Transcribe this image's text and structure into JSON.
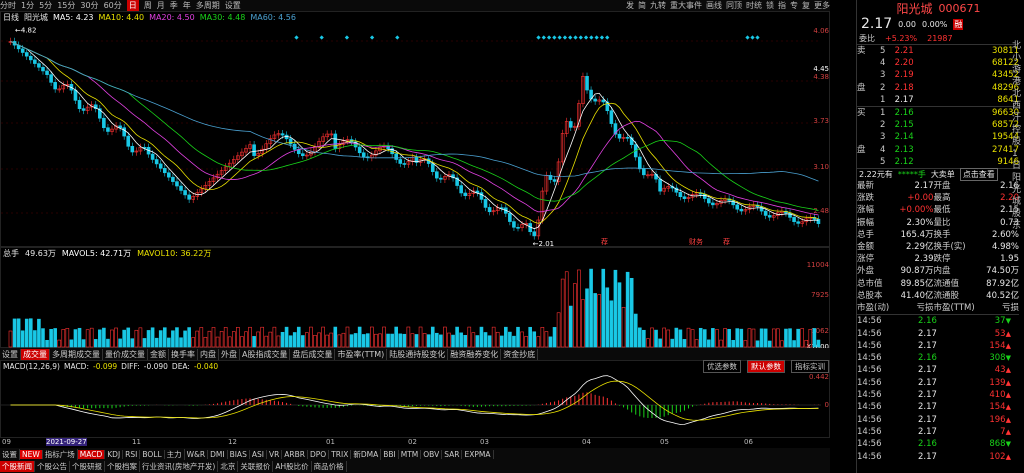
{
  "toolbar": {
    "periods": [
      "分时",
      "1分",
      "5分",
      "15分",
      "30分",
      "60分",
      "日",
      "周",
      "月",
      "季",
      "年",
      "多周期",
      "设置"
    ],
    "active_period": "日",
    "right_items": [
      "发",
      "简",
      "九转",
      "重大事件",
      "画线",
      "同顶",
      "时统",
      "锁",
      "指",
      "专",
      "复",
      "更多"
    ]
  },
  "price_panel": {
    "label": "日线",
    "name": "阳光城",
    "ma": [
      {
        "name": "MA5",
        "value": "4.23"
      },
      {
        "name": "MA10",
        "value": "4.40"
      },
      {
        "name": "MA20",
        "value": "4.50"
      },
      {
        "name": "MA30",
        "value": "4.48"
      },
      {
        "name": "MA60",
        "value": "4.56"
      }
    ],
    "axis": [
      "4.06",
      "4.45",
      "4.38",
      "3.73",
      "3.10",
      "2.48"
    ],
    "high_label": "4.82",
    "low_label": "2.01",
    "marks": [
      "荐",
      "财务",
      "荐"
    ]
  },
  "volume_panel": {
    "label": "总手",
    "value": "49.63万",
    "ma": [
      {
        "name": "MAVOL5",
        "value": "42.71万"
      },
      {
        "name": "MAVOL10",
        "value": "36.22万"
      }
    ],
    "axis": [
      "11004",
      "7925",
      "3062",
      "X1000"
    ]
  },
  "indicator_tabs": [
    "设置",
    "成交量",
    "多周期成交量",
    "量价成交量",
    "金额",
    "换手率",
    "内盘",
    "外盘",
    "A股指成交量",
    "盘后成交量",
    "市盈率(TTM)",
    "陆股通持股变化",
    "融资融券变化",
    "资金抄底"
  ],
  "macd_panel": {
    "label": "MACD(12,26,9)",
    "macd": "-0.099",
    "diff": "-0.090",
    "dea": "-0.040",
    "buttons": [
      "优选参数",
      "默认参数",
      "指标实训"
    ],
    "axis": [
      "0.442",
      "0"
    ]
  },
  "date_axis": {
    "labels": [
      "09",
      "2021-09-27",
      "11",
      "12",
      "01",
      "02",
      "03",
      "04",
      "05",
      "06"
    ]
  },
  "bottom_tabs": [
    "设置",
    "NEW",
    "指标广场",
    "MACD",
    "KDJ",
    "RSI",
    "BOLL",
    "主力",
    "W&R",
    "DMI",
    "BIAS",
    "ASI",
    "VR",
    "ARBR",
    "DPO",
    "TRIX",
    "新DMA",
    "BBI",
    "MTM",
    "OBV",
    "SAR",
    "EXPMA"
  ],
  "bottom_tabs2": [
    "个股新闻",
    "个股公告",
    "个股研报",
    "个股档案",
    "行业资讯(房地产开发)",
    "北京",
    "关联报价",
    "AH股比价",
    "商品价格"
  ],
  "quote": {
    "name": "阳光城",
    "code": "000671",
    "price": "2.17",
    "change": "0.00",
    "pct": "0.00%",
    "tag": "融",
    "weibi_label": "委比",
    "weibi": "+5.23%",
    "weicha": "21987",
    "asks": [
      {
        "lvl": "5",
        "price": "2.21",
        "vol": "30811"
      },
      {
        "lvl": "4",
        "price": "2.20",
        "vol": "68122"
      },
      {
        "lvl": "3",
        "price": "2.19",
        "vol": "43452"
      },
      {
        "lvl": "2",
        "price": "2.18",
        "vol": "48296"
      },
      {
        "lvl": "1",
        "price": "2.17",
        "vol": "8641"
      }
    ],
    "bids": [
      {
        "lvl": "1",
        "price": "2.16",
        "vol": "96630"
      },
      {
        "lvl": "2",
        "price": "2.15",
        "vol": "68572"
      },
      {
        "lvl": "3",
        "price": "2.14",
        "vol": "19544"
      },
      {
        "lvl": "4",
        "price": "2.13",
        "vol": "27417"
      },
      {
        "lvl": "5",
        "price": "2.12",
        "vol": "9146"
      }
    ],
    "ask_side": "卖",
    "bid_side": "买",
    "ask_mid": "盘",
    "bid_mid": "盘",
    "deal_bar": {
      "a": "2.22元有",
      "b": "*****手",
      "c": "大卖单",
      "btn": "点击查看"
    },
    "stats": [
      [
        "最新",
        "2.17",
        "开盘",
        "2.16"
      ],
      [
        "涨跌",
        "+0.00",
        "最高",
        "2.20"
      ],
      [
        "涨幅",
        "+0.00%",
        "最低",
        "2.15"
      ],
      [
        "振幅",
        "2.30%",
        "量比",
        "0.73"
      ],
      [
        "总手",
        "165.4万",
        "换手",
        "2.60%"
      ],
      [
        "金额",
        "2.29亿",
        "换手(实)",
        "4.98%"
      ],
      [
        "涨停",
        "2.39",
        "跌停",
        "1.95"
      ],
      [
        "外盘",
        "90.87万",
        "内盘",
        "74.50万"
      ],
      [
        "总市值",
        "89.85亿",
        "流通值",
        "87.92亿"
      ],
      [
        "总股本",
        "41.40亿",
        "流通股",
        "40.52亿"
      ],
      [
        "市盈(动)",
        "亏损",
        "市盈(TTM)",
        "亏损"
      ]
    ],
    "ticks": [
      [
        "14:56",
        "2.16",
        "37"
      ],
      [
        "14:56",
        "2.17",
        "53"
      ],
      [
        "14:56",
        "2.17",
        "154"
      ],
      [
        "14:56",
        "2.16",
        "308"
      ],
      [
        "14:56",
        "2.17",
        "43"
      ],
      [
        "14:56",
        "2.17",
        "139"
      ],
      [
        "14:56",
        "2.17",
        "410"
      ],
      [
        "14:56",
        "2.17",
        "154"
      ],
      [
        "14:56",
        "2.17",
        "196"
      ],
      [
        "14:56",
        "2.17",
        "7"
      ],
      [
        "14:56",
        "2.16",
        "868"
      ],
      [
        "14:56",
        "2.17",
        "102"
      ]
    ],
    "side_text": [
      "北",
      "小",
      "游",
      "港",
      "北",
      "西",
      "汗",
      "控",
      "股",
      "1",
      "日",
      "阳",
      "光",
      "城",
      "股",
      "东"
    ]
  },
  "colors": {
    "up": "#ff3232",
    "down": "#19d219",
    "ma5": "#ffffff",
    "ma10": "#e8e000",
    "ma20": "#e040e0",
    "ma30": "#19d219",
    "ma60": "#4aa0d0"
  }
}
